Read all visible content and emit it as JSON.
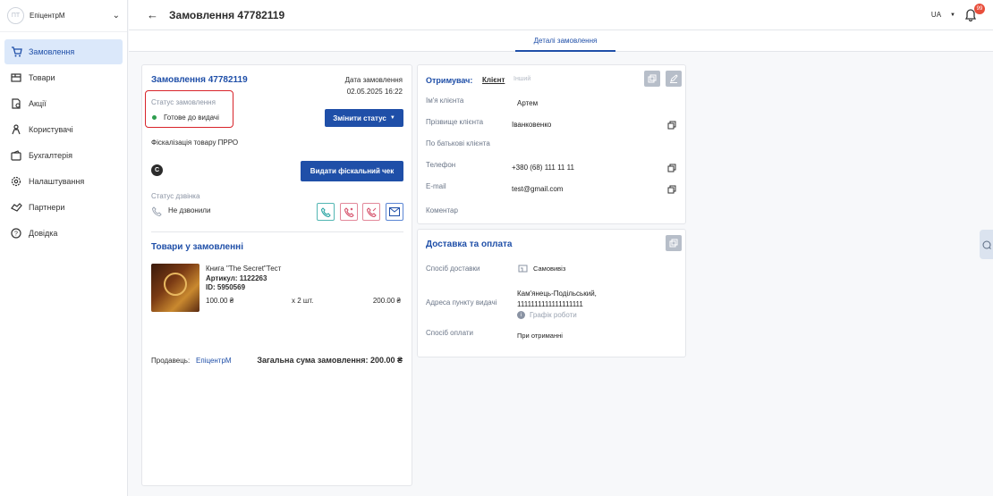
{
  "sidebar": {
    "org_initials": "ПТ",
    "org_name": "ЕпіцентрМ",
    "items": [
      {
        "label": "Замовлення",
        "icon": "cart-icon",
        "active": true
      },
      {
        "label": "Товари",
        "icon": "box-icon"
      },
      {
        "label": "Акції",
        "icon": "promo-icon"
      },
      {
        "label": "Користувачі",
        "icon": "users-icon"
      },
      {
        "label": "Бухгалтерія",
        "icon": "wallet-icon"
      },
      {
        "label": "Налаштування",
        "icon": "gear-icon"
      },
      {
        "label": "Партнери",
        "icon": "handshake-icon"
      },
      {
        "label": "Довідка",
        "icon": "help-icon"
      }
    ]
  },
  "header": {
    "title": "Замовлення 47782119",
    "language": "UA",
    "notifications_count": "99"
  },
  "tabs": {
    "active": "Деталі замовлення"
  },
  "order": {
    "title": "Замовлення 47782119",
    "date_label": "Дата замовлення",
    "date_value": "02.05.2025 16:22",
    "status_label": "Статус замовлення",
    "status_value": "Готове до видачі",
    "status_color": "#2e9d4e",
    "change_status_button": "Змінити статус",
    "fiscal_label": "Фіскалізація товару ПРРО",
    "fiscal_badge": "C",
    "fiscal_button": "Видати фіскальний чек",
    "call_status_label": "Статус дзвінка",
    "call_status_value": "Не дзвонили",
    "goods_title": "Товари у замовленні",
    "item": {
      "name": "Книга \"The Secret\"Тест",
      "article": "Артикул: 1122263",
      "id": "ID: 5950569",
      "price": "100.00 ₴",
      "qty": "x 2 шт.",
      "total": "200.00 ₴"
    },
    "seller_label": "Продавець:",
    "seller_name": "ЕпіцентрМ",
    "total_label": "Загальна сума замовлення: 200.00 ₴"
  },
  "recipient": {
    "label": "Отримувач:",
    "tab_client": "Клієнт",
    "tab_other": "Інший",
    "first_name_label": "Ім'я клієнта",
    "first_name": "Артем",
    "last_name_label": "Прізвище клієнта",
    "last_name": "Іванковенко",
    "patronymic_label": "По батькові клієнта",
    "phone_label": "Телефон",
    "phone": "+380 (68) 111 11 11",
    "email_label": "E-mail",
    "email": "test@gmail.com",
    "comment_label": "Коментар"
  },
  "delivery": {
    "title": "Доставка та оплата",
    "method_label": "Спосіб доставки",
    "method_value": "Самовивіз",
    "address_label": "Адреса пункту видачі",
    "address_line1": "Кам'янець-Подільський,",
    "address_line2": "1111111111111111111",
    "schedule_link": "Графік роботи",
    "payment_label": "Спосіб оплати",
    "payment_value": "При отриманні"
  },
  "colors": {
    "accent": "#1f4fa8",
    "highlight": "#d8232a"
  }
}
